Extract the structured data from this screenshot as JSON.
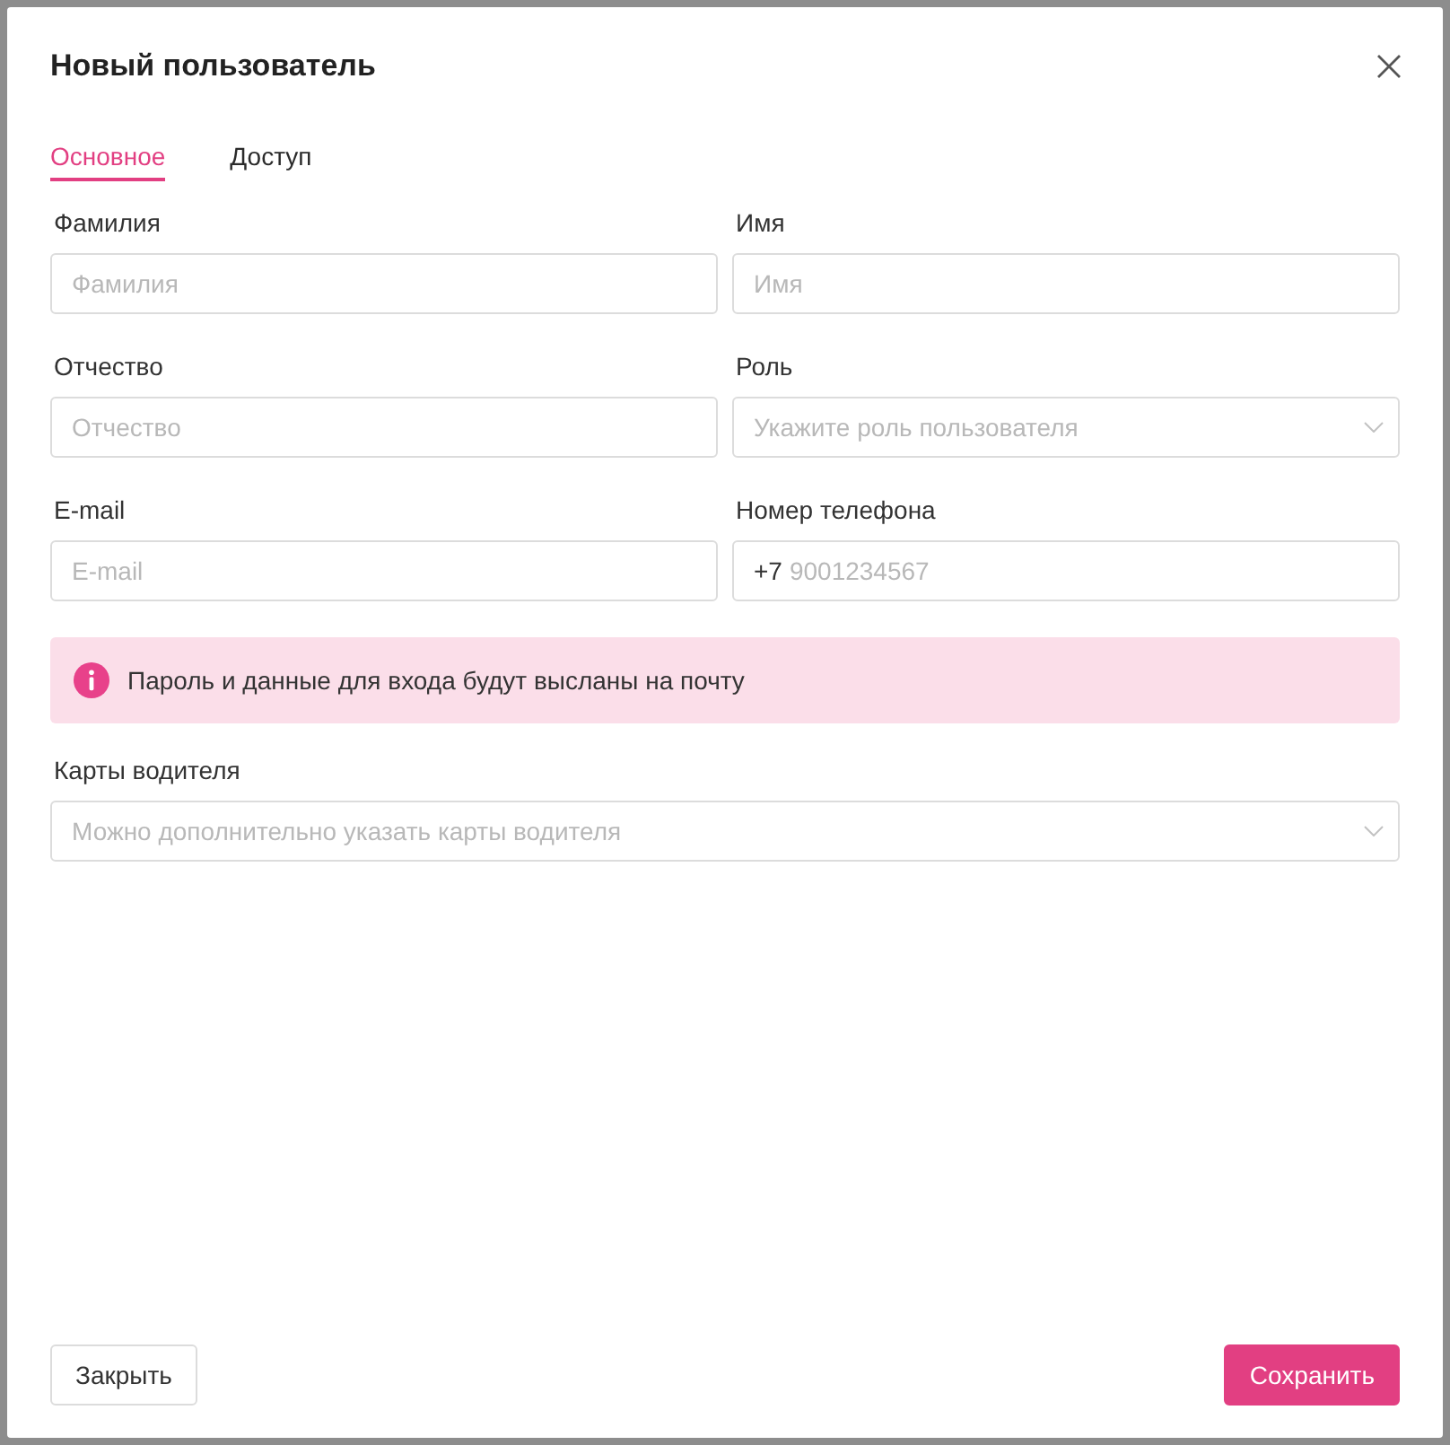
{
  "dialog": {
    "title": "Новый пользователь"
  },
  "tabs": [
    {
      "label": "Основное",
      "selected": true
    },
    {
      "label": "Доступ",
      "selected": false
    }
  ],
  "fields": [
    {
      "kind": "text",
      "label": "Фамилия",
      "placeholder": "Фамилия"
    },
    {
      "kind": "text",
      "label": "Имя",
      "placeholder": "Имя"
    },
    {
      "kind": "text",
      "label": "Отчество",
      "placeholder": "Отчество"
    },
    {
      "kind": "select",
      "label": "Роль",
      "placeholder": "Укажите роль пользователя"
    },
    {
      "kind": "text",
      "label": "E-mail",
      "placeholder": "E-mail"
    },
    {
      "kind": "phone",
      "label": "Номер телефона",
      "prefix": "+7",
      "placeholder": "9001234567"
    }
  ],
  "notice": {
    "text": "Пароль и данные для входа будут высланы на почту"
  },
  "driver_cards": {
    "kind": "select",
    "label": "Карты водителя",
    "placeholder": "Можно дополнительно указать карты водителя"
  },
  "buttons": [
    {
      "kind": "secondary",
      "label": "Закрыть"
    },
    {
      "kind": "primary",
      "label": "Сохранить"
    }
  ]
}
